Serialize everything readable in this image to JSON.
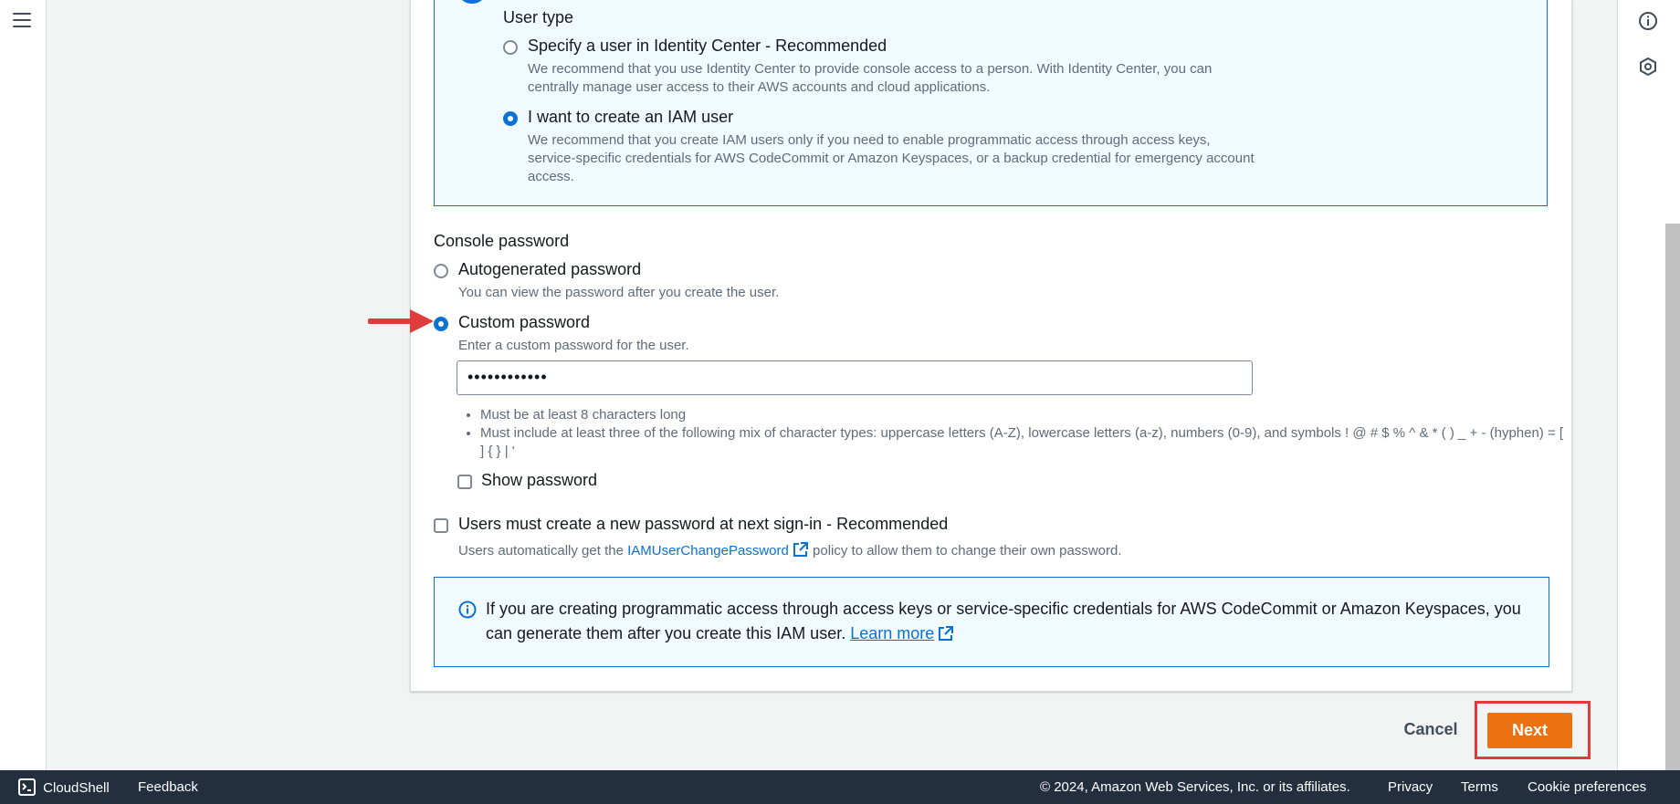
{
  "user_type": {
    "heading": "User type",
    "options": [
      {
        "label": "Specify a user in Identity Center - Recommended",
        "description_line1": "We recommend that you use Identity Center to provide console access to a person. With Identity Center, you can",
        "description_line2": "centrally manage user access to their AWS accounts and cloud applications.",
        "selected": false
      },
      {
        "label": "I want to create an IAM user",
        "description_line1": "We recommend that you create IAM users only if you need to enable programmatic access through access keys,",
        "description_line2": "service-specific credentials for AWS CodeCommit or Amazon Keyspaces, or a backup credential for emergency account",
        "description_line3": "access.",
        "selected": true
      }
    ]
  },
  "console_password": {
    "heading": "Console password",
    "autogenerated": {
      "label": "Autogenerated password",
      "description": "You can view the password after you create the user."
    },
    "custom": {
      "label": "Custom password",
      "description": "Enter a custom password for the user.",
      "value": "••••••••••••"
    },
    "rules": [
      "Must be at least 8 characters long",
      "Must include at least three of the following mix of character types: uppercase letters (A-Z), lowercase letters (a-z), numbers (0-9), and symbols ! @ # $ % ^ & * ( ) _ + - (hyphen) = [ ] { } | '"
    ],
    "show_password_label": "Show password"
  },
  "reset": {
    "label": "Users must create a new password at next sign-in - Recommended",
    "desc_before": "Users automatically get the ",
    "link": "IAMUserChangePassword",
    "desc_after": " policy to allow them to change their own password."
  },
  "info": {
    "text": "If you are creating programmatic access through access keys or service-specific credentials for AWS CodeCommit or Amazon Keyspaces, you can generate them after you create this IAM user.",
    "link": "Learn more"
  },
  "actions": {
    "cancel": "Cancel",
    "next": "Next"
  },
  "footer": {
    "cloudshell": "CloudShell",
    "feedback": "Feedback",
    "copyright": "© 2024, Amazon Web Services, Inc. or its affiliates.",
    "privacy": "Privacy",
    "terms": "Terms",
    "cookies": "Cookie preferences"
  },
  "colors": {
    "accent": "#0972d3",
    "primary_button": "#ec7211",
    "annotation": "#e23b3b",
    "footer_bg": "#232f3e"
  }
}
